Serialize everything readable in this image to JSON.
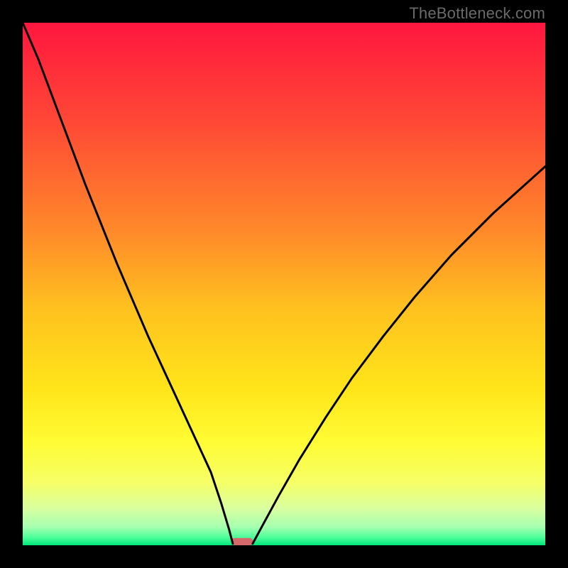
{
  "watermark": "TheBottleneck.com",
  "chart_data": {
    "type": "line",
    "title": "",
    "xlabel": "",
    "ylabel": "",
    "xlim": [
      0,
      100
    ],
    "ylim": [
      0,
      100
    ],
    "grid": false,
    "gradient_stops": [
      {
        "offset": 0.0,
        "color": "#ff163f"
      },
      {
        "offset": 0.2,
        "color": "#ff4b35"
      },
      {
        "offset": 0.4,
        "color": "#ff8a2a"
      },
      {
        "offset": 0.55,
        "color": "#ffc21f"
      },
      {
        "offset": 0.7,
        "color": "#ffe51a"
      },
      {
        "offset": 0.8,
        "color": "#fffb33"
      },
      {
        "offset": 0.88,
        "color": "#f6ff66"
      },
      {
        "offset": 0.93,
        "color": "#d9ffa0"
      },
      {
        "offset": 0.965,
        "color": "#a6ffb0"
      },
      {
        "offset": 0.985,
        "color": "#4dff9a"
      },
      {
        "offset": 1.0,
        "color": "#00e57a"
      }
    ],
    "series": [
      {
        "name": "left_curve",
        "x": [
          0.0,
          3.0,
          6.0,
          9.0,
          12.0,
          15.0,
          18.0,
          21.0,
          24.0,
          27.0,
          30.0,
          33.0,
          36.0,
          38.0,
          39.5,
          40.2
        ],
        "y": [
          100.0,
          93.0,
          85.0,
          77.0,
          69.0,
          61.5,
          54.0,
          47.0,
          40.0,
          33.5,
          27.0,
          20.5,
          14.0,
          8.0,
          3.0,
          0.3
        ]
      },
      {
        "name": "right_curve",
        "x": [
          44.0,
          46.0,
          49.0,
          53.0,
          58.0,
          63.0,
          69.0,
          75.0,
          82.0,
          90.0,
          100.0
        ],
        "y": [
          0.3,
          4.0,
          9.5,
          16.5,
          24.5,
          32.0,
          40.0,
          47.5,
          55.5,
          63.5,
          72.5
        ]
      }
    ],
    "bottleneck_marker": {
      "x_center": 42.0,
      "width": 4.0,
      "color": "#d66a6a",
      "height_pct": 1.4
    }
  }
}
